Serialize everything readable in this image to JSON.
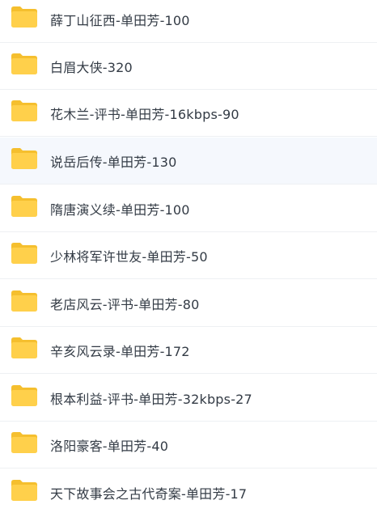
{
  "folder_color": "#ffd04b",
  "folder_tab_color": "#f5bf2e",
  "highlight_color": "#f5f8fd",
  "icon": "folder-icon",
  "files": [
    {
      "name": "薛丁山征西-单田芳-100",
      "highlighted": false
    },
    {
      "name": "白眉大侠-320",
      "highlighted": false
    },
    {
      "name": "花木兰-评书-单田芳-16kbps-90",
      "highlighted": false
    },
    {
      "name": "说岳后传-单田芳-130",
      "highlighted": true
    },
    {
      "name": "隋唐演义续-单田芳-100",
      "highlighted": false
    },
    {
      "name": "少林将军许世友-单田芳-50",
      "highlighted": false
    },
    {
      "name": "老店风云-评书-单田芳-80",
      "highlighted": false
    },
    {
      "name": "辛亥风云录-单田芳-172",
      "highlighted": false
    },
    {
      "name": "根本利益-评书-单田芳-32kbps-27",
      "highlighted": false
    },
    {
      "name": "洛阳豪客-单田芳-40",
      "highlighted": false
    },
    {
      "name": "天下故事会之古代奇案-单田芳-17",
      "highlighted": false
    }
  ]
}
